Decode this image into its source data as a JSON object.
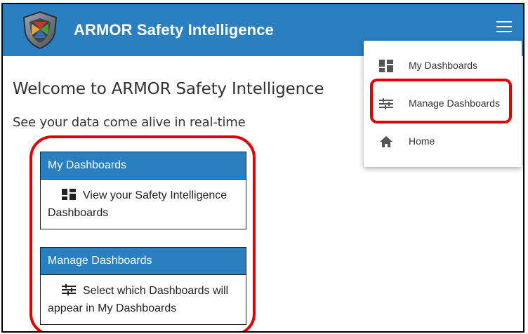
{
  "app": {
    "title": "ARMOR Safety Intelligence"
  },
  "page": {
    "welcome": "Welcome to ARMOR Safety Intelligence",
    "tagline": "See your data come alive in real-time"
  },
  "cards": [
    {
      "title": "My Dashboards",
      "icon": "dashboard-icon",
      "description": "View your Safety Intelligence Dashboards"
    },
    {
      "title": "Manage Dashboards",
      "icon": "tune-icon",
      "description": "Select which Dashboards will appear in My Dashboards"
    }
  ],
  "menu": {
    "items": [
      {
        "label": "My Dashboards",
        "icon": "dashboard-icon"
      },
      {
        "label": "Manage Dashboards",
        "icon": "tune-icon"
      },
      {
        "label": "Home",
        "icon": "home-icon"
      }
    ]
  },
  "colors": {
    "appbar": "#2a7fc0",
    "highlight": "#e00000"
  }
}
